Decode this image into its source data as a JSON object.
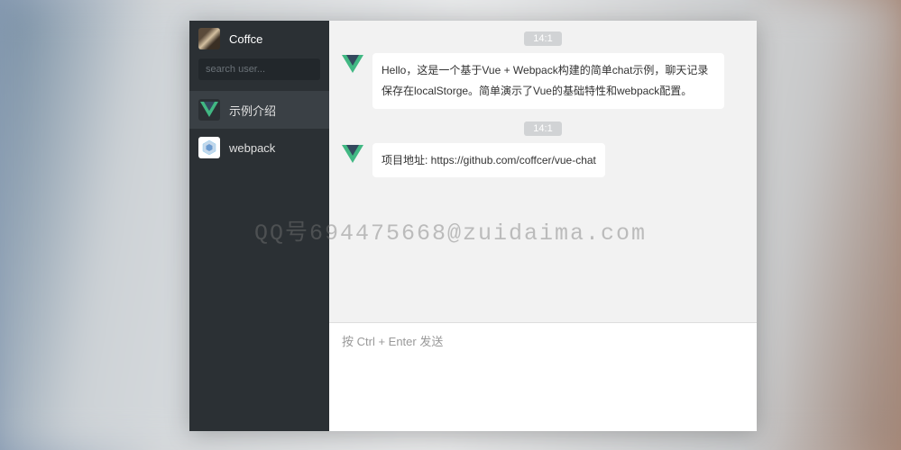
{
  "user": {
    "name": "Coffce"
  },
  "search": {
    "placeholder": "search user..."
  },
  "contacts": [
    {
      "name": "示例介绍",
      "avatar_type": "vue",
      "active": true
    },
    {
      "name": "webpack",
      "avatar_type": "webpack",
      "active": false
    }
  ],
  "messages": [
    {
      "time": "14:1",
      "avatar_type": "vue",
      "text": "Hello，这是一个基于Vue + Webpack构建的简单chat示例，聊天记录保存在localStorge。简单演示了Vue的基础特性和webpack配置。"
    },
    {
      "time": "14:1",
      "avatar_type": "vue",
      "text": "项目地址: https://github.com/coffcer/vue-chat"
    }
  ],
  "input": {
    "placeholder": "按 Ctrl + Enter 发送"
  },
  "watermark": "QQ号694475668@zuidaima.com"
}
